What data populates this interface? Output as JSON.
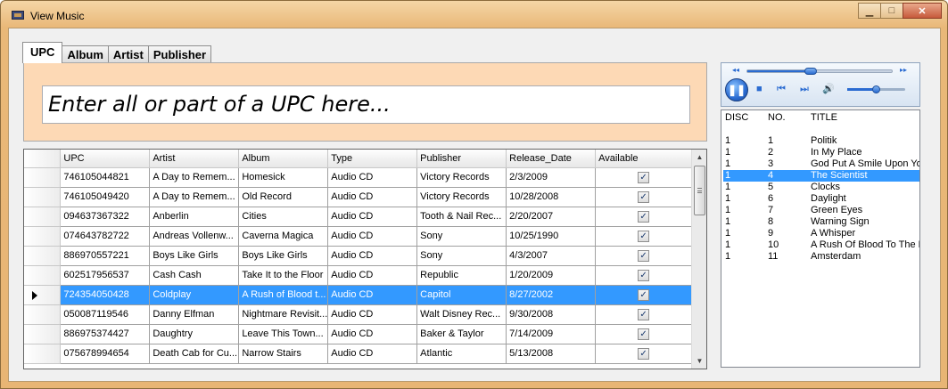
{
  "window": {
    "title": "View Music",
    "controls": {
      "minimize": "▁",
      "maximize": "□",
      "close": "✕"
    }
  },
  "tabs": [
    {
      "label": "UPC",
      "active": true
    },
    {
      "label": "Album",
      "active": false
    },
    {
      "label": "Artist",
      "active": false
    },
    {
      "label": "Publisher",
      "active": false
    }
  ],
  "search": {
    "placeholder": "Enter all or part of a UPC here..."
  },
  "grid": {
    "columns": [
      "UPC",
      "Artist",
      "Album",
      "Type",
      "Publisher",
      "Release_Date",
      "Available"
    ],
    "rows": [
      {
        "upc": "746105044821",
        "artist": "A Day to Remem...",
        "album": "Homesick",
        "type": "Audio CD",
        "publisher": "Victory Records",
        "release_date": "2/3/2009",
        "available": true
      },
      {
        "upc": "746105049420",
        "artist": "A Day to Remem...",
        "album": "Old Record",
        "type": "Audio CD",
        "publisher": "Victory Records",
        "release_date": "10/28/2008",
        "available": true
      },
      {
        "upc": "094637367322",
        "artist": "Anberlin",
        "album": "Cities",
        "type": "Audio CD",
        "publisher": "Tooth & Nail Rec...",
        "release_date": "2/20/2007",
        "available": true
      },
      {
        "upc": "074643782722",
        "artist": "Andreas Vollenw...",
        "album": "Caverna Magica",
        "type": "Audio CD",
        "publisher": "Sony",
        "release_date": "10/25/1990",
        "available": true
      },
      {
        "upc": "886970557221",
        "artist": "Boys Like Girls",
        "album": "Boys Like Girls",
        "type": "Audio CD",
        "publisher": "Sony",
        "release_date": "4/3/2007",
        "available": true
      },
      {
        "upc": "602517956537",
        "artist": "Cash Cash",
        "album": "Take It to the Floor",
        "type": "Audio CD",
        "publisher": "Republic",
        "release_date": "1/20/2009",
        "available": true
      },
      {
        "upc": "724354050428",
        "artist": "Coldplay",
        "album": "A Rush of Blood t...",
        "type": "Audio CD",
        "publisher": "Capitol",
        "release_date": "8/27/2002",
        "available": true,
        "selected": true
      },
      {
        "upc": "050087119546",
        "artist": "Danny Elfman",
        "album": "Nightmare Revisit...",
        "type": "Audio CD",
        "publisher": "Walt Disney Rec...",
        "release_date": "9/30/2008",
        "available": true
      },
      {
        "upc": "886975374427",
        "artist": "Daughtry",
        "album": "Leave This Town...",
        "type": "Audio CD",
        "publisher": "Baker & Taylor",
        "release_date": "7/14/2009",
        "available": true
      },
      {
        "upc": "075678994654",
        "artist": "Death Cab for Cu...",
        "album": "Narrow Stairs",
        "type": "Audio CD",
        "publisher": "Atlantic",
        "release_date": "5/13/2008",
        "available": true
      }
    ]
  },
  "player": {
    "seek_progress": 0.43,
    "volume_level": 0.5,
    "icons": {
      "rewind": "◂◂",
      "forward": "▸▸",
      "pause": "❚❚",
      "stop": "■",
      "prev": "⏮",
      "next": "⏭",
      "volume": "🔊"
    }
  },
  "tracks": {
    "headers": {
      "disc": "DISC",
      "no": "NO.",
      "title": "TITLE"
    },
    "rows": [
      {
        "disc": "1",
        "no": "1",
        "title": "Politik"
      },
      {
        "disc": "1",
        "no": "2",
        "title": "In My Place"
      },
      {
        "disc": "1",
        "no": "3",
        "title": "God Put A Smile Upon Your"
      },
      {
        "disc": "1",
        "no": "4",
        "title": "The Scientist",
        "selected": true
      },
      {
        "disc": "1",
        "no": "5",
        "title": "Clocks"
      },
      {
        "disc": "1",
        "no": "6",
        "title": "Daylight"
      },
      {
        "disc": "1",
        "no": "7",
        "title": "Green Eyes"
      },
      {
        "disc": "1",
        "no": "8",
        "title": "Warning Sign"
      },
      {
        "disc": "1",
        "no": "9",
        "title": "A Whisper"
      },
      {
        "disc": "1",
        "no": "10",
        "title": "A Rush Of Blood To The H"
      },
      {
        "disc": "1",
        "no": "11",
        "title": "Amsterdam"
      }
    ]
  }
}
